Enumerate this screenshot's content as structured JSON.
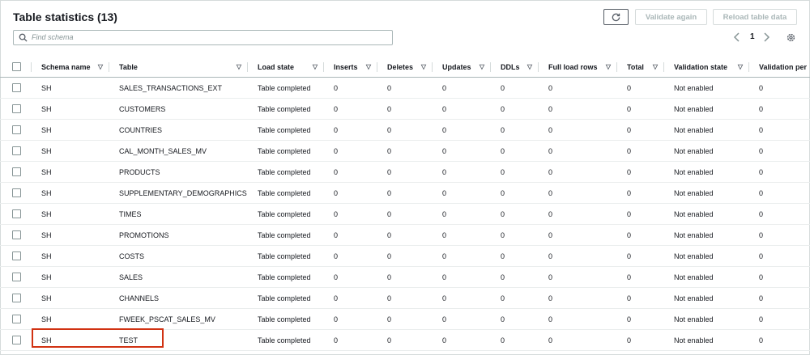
{
  "header": {
    "title": "Table statistics (13)",
    "refresh_icon": "refresh-icon",
    "validate_again_label": "Validate again",
    "reload_table_data_label": "Reload table data"
  },
  "search": {
    "placeholder": "Find schema",
    "icon": "search-icon"
  },
  "pagination": {
    "prev_icon": "chevron-left-icon",
    "current_page": "1",
    "next_icon": "chevron-right-icon"
  },
  "settings_icon": "gear-icon",
  "colors": {
    "highlight": "#d13212",
    "disabled_text": "#aab7b8"
  },
  "table": {
    "columns": [
      "Schema name",
      "Table",
      "Load state",
      "Inserts",
      "Deletes",
      "Updates",
      "DDLs",
      "Full load rows",
      "Total",
      "Validation state",
      "Validation per"
    ],
    "rows": [
      [
        "SH",
        "SALES_TRANSACTIONS_EXT",
        "Table completed",
        "0",
        "0",
        "0",
        "0",
        "0",
        "0",
        "Not enabled",
        "0"
      ],
      [
        "SH",
        "CUSTOMERS",
        "Table completed",
        "0",
        "0",
        "0",
        "0",
        "0",
        "0",
        "Not enabled",
        "0"
      ],
      [
        "SH",
        "COUNTRIES",
        "Table completed",
        "0",
        "0",
        "0",
        "0",
        "0",
        "0",
        "Not enabled",
        "0"
      ],
      [
        "SH",
        "CAL_MONTH_SALES_MV",
        "Table completed",
        "0",
        "0",
        "0",
        "0",
        "0",
        "0",
        "Not enabled",
        "0"
      ],
      [
        "SH",
        "PRODUCTS",
        "Table completed",
        "0",
        "0",
        "0",
        "0",
        "0",
        "0",
        "Not enabled",
        "0"
      ],
      [
        "SH",
        "SUPPLEMENTARY_DEMOGRAPHICS",
        "Table completed",
        "0",
        "0",
        "0",
        "0",
        "0",
        "0",
        "Not enabled",
        "0"
      ],
      [
        "SH",
        "TIMES",
        "Table completed",
        "0",
        "0",
        "0",
        "0",
        "0",
        "0",
        "Not enabled",
        "0"
      ],
      [
        "SH",
        "PROMOTIONS",
        "Table completed",
        "0",
        "0",
        "0",
        "0",
        "0",
        "0",
        "Not enabled",
        "0"
      ],
      [
        "SH",
        "COSTS",
        "Table completed",
        "0",
        "0",
        "0",
        "0",
        "0",
        "0",
        "Not enabled",
        "0"
      ],
      [
        "SH",
        "SALES",
        "Table completed",
        "0",
        "0",
        "0",
        "0",
        "0",
        "0",
        "Not enabled",
        "0"
      ],
      [
        "SH",
        "CHANNELS",
        "Table completed",
        "0",
        "0",
        "0",
        "0",
        "0",
        "0",
        "Not enabled",
        "0"
      ],
      [
        "SH",
        "FWEEK_PSCAT_SALES_MV",
        "Table completed",
        "0",
        "0",
        "0",
        "0",
        "0",
        "0",
        "Not enabled",
        "0"
      ],
      [
        "SH",
        "TEST",
        "Table completed",
        "0",
        "0",
        "0",
        "0",
        "0",
        "0",
        "Not enabled",
        "0"
      ]
    ]
  }
}
